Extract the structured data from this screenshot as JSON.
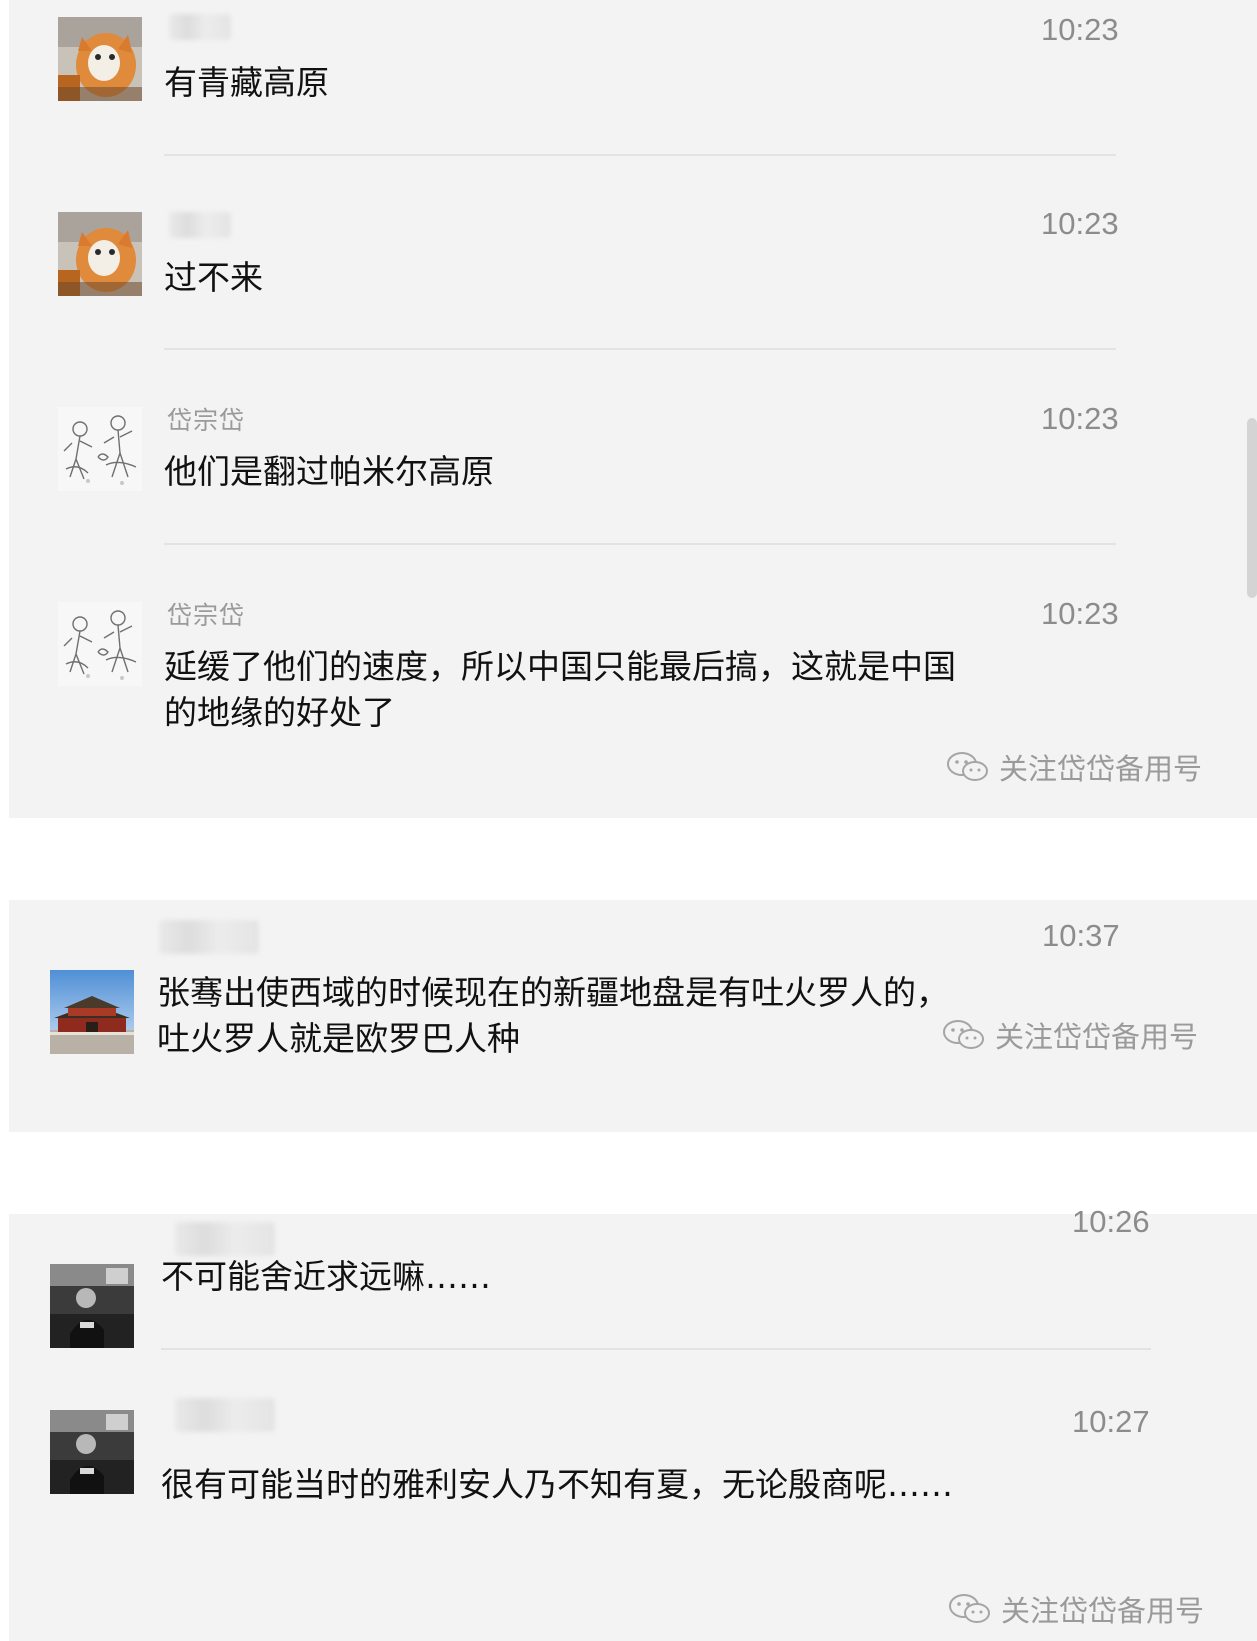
{
  "panels": [
    {
      "messages": [
        {
          "sender": "",
          "time": "10:23",
          "content": "有青藏高原",
          "avatar": "orange-cat-avatar"
        },
        {
          "sender": "",
          "time": "10:23",
          "content": "过不来",
          "avatar": "orange-cat-avatar"
        },
        {
          "sender": "岱宗岱",
          "time": "10:23",
          "content": "他们是翻过帕米尔高原",
          "avatar": "sketch-figures-avatar"
        },
        {
          "sender": "岱宗岱",
          "time": "10:23",
          "content": "延缓了他们的速度，所以中国只能最后搞，这就是中国的地缘的好处了",
          "avatar": "sketch-figures-avatar"
        }
      ],
      "watermark": "关注岱岱备用号"
    },
    {
      "messages": [
        {
          "sender": "",
          "time": "10:37",
          "content": "张骞出使西域的时候现在的新疆地盘是有吐火罗人的，吐火罗人就是欧罗巴人种",
          "avatar": "palace-avatar"
        }
      ],
      "watermark": "关注岱岱备用号"
    },
    {
      "messages": [
        {
          "sender": "",
          "time": "10:26",
          "content": "不可能舍近求远嘛……",
          "avatar": "man-photo-avatar"
        },
        {
          "sender": "",
          "time": "10:27",
          "content": "很有可能当时的雅利安人乃不知有夏，无论殷商呢……",
          "avatar": "man-photo-avatar"
        }
      ],
      "watermark": "关注岱岱备用号"
    }
  ]
}
